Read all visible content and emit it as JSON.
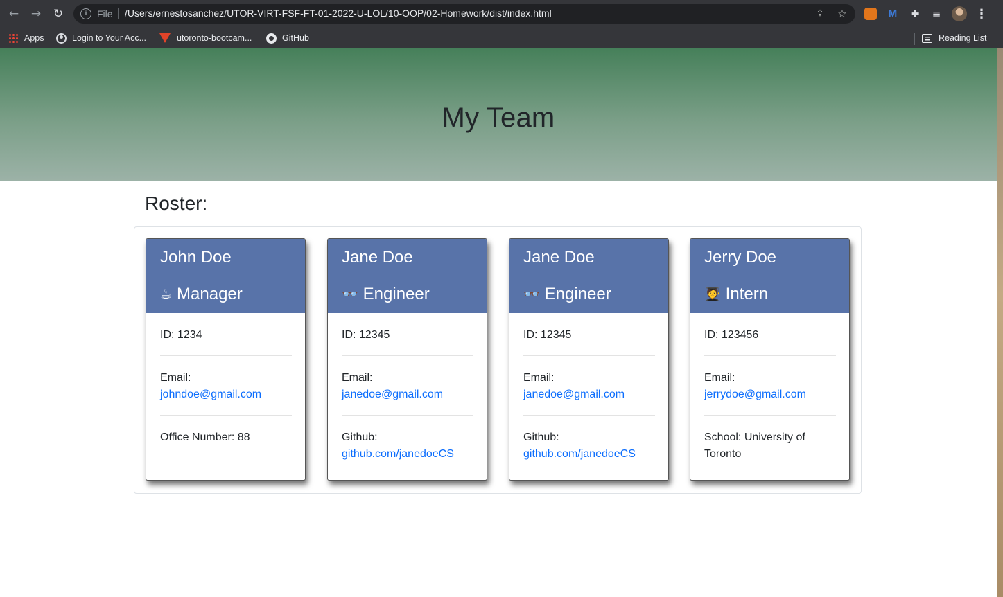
{
  "browser": {
    "address_prefix": "File",
    "url": "/Users/ernestosanchez/UTOR-VIRT-FSF-FT-01-2022-U-LOL/10-OOP/02-Homework/dist/index.html",
    "bookmarks": [
      {
        "label": "Apps",
        "icon": "apps-grid-icon"
      },
      {
        "label": "Login to Your Acc...",
        "icon": "globe-icon"
      },
      {
        "label": "utoronto-bootcam...",
        "icon": "gitlab-icon"
      },
      {
        "label": "GitHub",
        "icon": "github-icon"
      }
    ],
    "reading_list": "Reading List"
  },
  "page": {
    "title": "My Team",
    "roster_heading": "Roster:",
    "header_color": "#46805a",
    "card_header_color": "#5873a9",
    "link_color": "#0d6efd"
  },
  "cards": [
    {
      "name": "John Doe",
      "role_icon": "☕",
      "role": "Manager",
      "id": "ID: 1234",
      "email_label": "Email:",
      "email": "johndoe@gmail.com",
      "extra_label": "Office Number: 88",
      "extra_link": ""
    },
    {
      "name": "Jane Doe",
      "role_icon": "👓",
      "role": "Engineer",
      "id": "ID: 12345",
      "email_label": "Email:",
      "email": "janedoe@gmail.com",
      "extra_label": "Github:",
      "extra_link": "github.com/janedoeCS"
    },
    {
      "name": "Jane Doe",
      "role_icon": "👓",
      "role": "Engineer",
      "id": "ID: 12345",
      "email_label": "Email:",
      "email": "janedoe@gmail.com",
      "extra_label": "Github:",
      "extra_link": "github.com/janedoeCS"
    },
    {
      "name": "Jerry Doe",
      "role_icon": "🧑‍🎓",
      "role": "Intern",
      "id": "ID: 123456",
      "email_label": "Email:",
      "email": "jerrydoe@gmail.com",
      "extra_label": "School: University of Toronto",
      "extra_link": ""
    }
  ]
}
